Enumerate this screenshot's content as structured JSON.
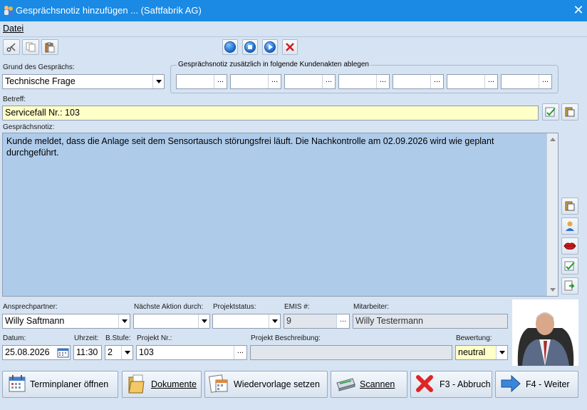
{
  "window": {
    "title": "Gesprächsnotiz hinzufügen ...  (Saftfabrik AG)"
  },
  "menu": {
    "datei": "Datei"
  },
  "icons": {
    "app": "people-icon",
    "close": "close-icon",
    "cut": "scissors-icon",
    "copy": "copy-icon",
    "paste": "paste-icon",
    "record": "record-icon",
    "stop": "stop-icon",
    "play": "play-icon",
    "delete": "delete-x-icon"
  },
  "form": {
    "grund_label": "Grund des Gesprächs:",
    "grund_value": "Technische Frage",
    "kundenakten_label": "Gesprächsnotiz zusätzlich in folgende Kundenakten ablegen",
    "betreff_label": "Betreff:",
    "betreff_value": "Servicefall Nr.: 103",
    "notiz_label": "Gesprächsnotiz:",
    "notiz_value": "Kunde meldet, dass die Anlage seit dem Sensortausch störungsfrei läuft. Die Nachkontrolle am 02.09.2026 wird wie geplant durchgeführt.",
    "ansprechpartner_label": "Ansprechpartner:",
    "ansprechpartner_value": "Willy Saftmann",
    "naechste_label": "Nächste Aktion durch:",
    "naechste_value": "",
    "projektstatus_label": "Projektstatus:",
    "projektstatus_value": "",
    "emis_label": "EMIS #:",
    "emis_value": "9",
    "mitarbeiter_label": "Mitarbeiter:",
    "mitarbeiter_value": "Willy Testermann",
    "datum_label": "Datum:",
    "datum_value": "25.08.2026",
    "uhrzeit_label": "Uhrzeit:",
    "uhrzeit_value": "11:30",
    "bstufe_label": "B.Stufe:",
    "bstufe_value": "2",
    "projektnr_label": "Projekt Nr.:",
    "projektnr_value": "103",
    "projektbeschr_label": "Projekt Beschreibung:",
    "projektbeschr_value": "",
    "bewertung_label": "Bewertung:",
    "bewertung_value": "neutral",
    "ellipsis": "..."
  },
  "buttons": {
    "terminplaner": "Terminplaner öffnen",
    "dokumente": "Dokumente",
    "wiedervorlage": "Wiedervorlage setzen",
    "scannen": "Scannen",
    "abbruch": "F3 - Abbruch",
    "weiter": "F4 - Weiter"
  },
  "colors": {
    "titlebar": "#1a8ae4",
    "background": "#d6e3f2",
    "notes_area": "#aecbea",
    "highlight_field": "#ffffc8"
  }
}
